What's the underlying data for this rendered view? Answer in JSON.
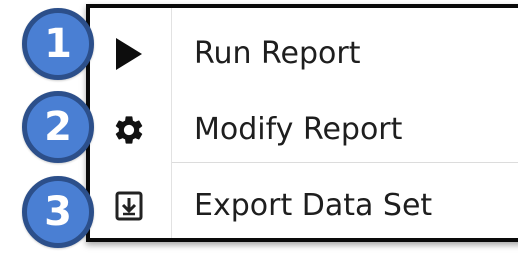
{
  "menu": {
    "items": [
      {
        "label": "Run Report",
        "icon": "play-icon"
      },
      {
        "label": "Modify Report",
        "icon": "gear-icon"
      },
      {
        "label": "Export Data Set",
        "icon": "download-icon"
      }
    ]
  },
  "callouts": [
    "1",
    "2",
    "3"
  ],
  "colors": {
    "badge_fill": "#4a7fd3",
    "badge_border": "#2c4f8a",
    "menu_border": "#0a0a0a",
    "text": "#1e1e1e"
  }
}
